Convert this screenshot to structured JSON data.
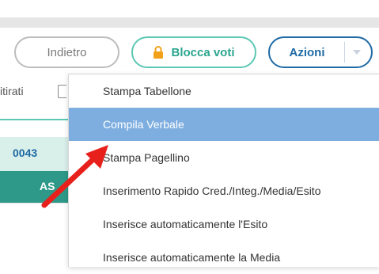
{
  "toolbar": {
    "back_label": "Indietro",
    "lock_label": "Blocca voti",
    "actions_label": "Azioni"
  },
  "left": {
    "filter_label": "itirati",
    "code": "0043",
    "sub": "AS"
  },
  "menu": {
    "items": [
      {
        "label": "Stampa Tabellone"
      },
      {
        "label": "Compila Verbale"
      },
      {
        "label": "Stampa Pagellino"
      },
      {
        "label": "Inserimento Rapido Cred./Integ./Media/Esito"
      },
      {
        "label": "Inserisce automaticamente l'Esito"
      },
      {
        "label": "Inserisce automaticamente la Media"
      }
    ]
  },
  "colors": {
    "teal": "#5cc8b4",
    "blue": "#1f6aa5",
    "highlight": "#7eaee0",
    "arrow": "#e8201c",
    "lock": "#f2a21a"
  },
  "icons": {
    "lock": "lock-icon",
    "caret": "chevron-down-icon",
    "arrow": "red-arrow-annotation"
  }
}
